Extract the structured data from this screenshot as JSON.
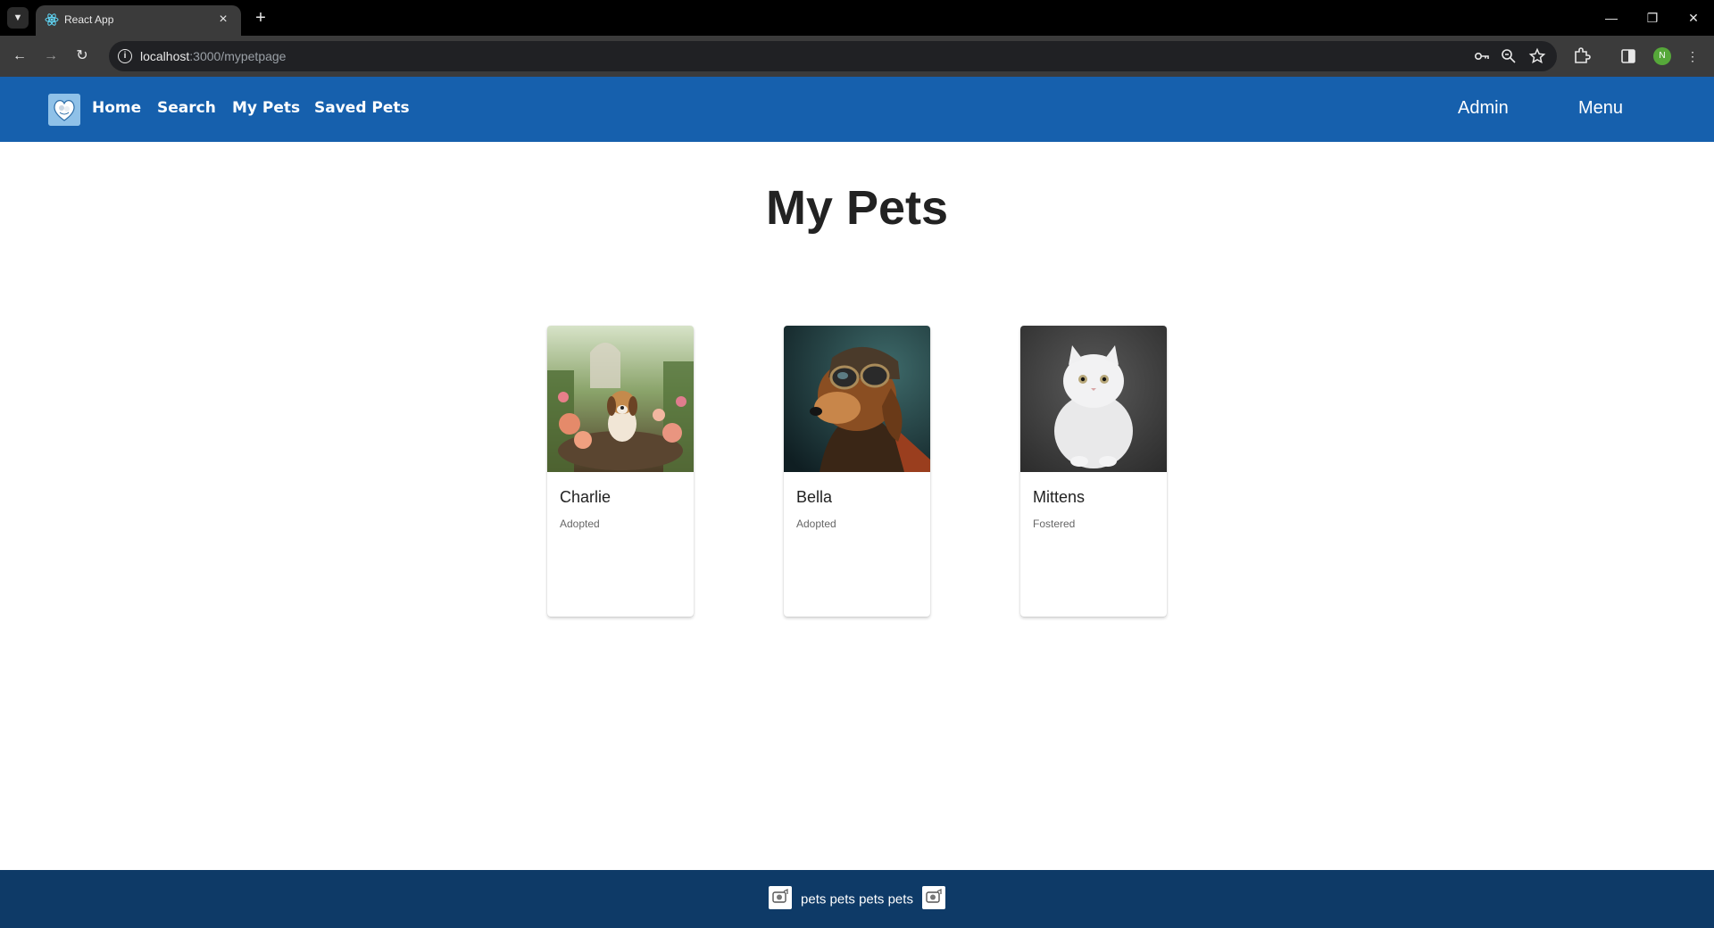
{
  "browser": {
    "tab_title": "React App",
    "url_host": "localhost",
    "url_rest": ":3000/mypetpage",
    "profile_initial": "N"
  },
  "header": {
    "nav": {
      "home": "Home",
      "search": "Search",
      "my_pets": "My Pets",
      "saved_pets": "Saved Pets"
    },
    "admin": "Admin",
    "menu": "Menu",
    "brand_color": "#1660ad"
  },
  "page": {
    "title": "My Pets"
  },
  "pets": [
    {
      "name": "Charlie",
      "status": "Adopted",
      "image": "beagle-in-garden"
    },
    {
      "name": "Bella",
      "status": "Adopted",
      "image": "dog-with-aviator-goggles"
    },
    {
      "name": "Mittens",
      "status": "Fostered",
      "image": "white-persian-cat"
    }
  ],
  "footer": {
    "text": "pets pets pets pets",
    "color": "#0e3a67"
  }
}
